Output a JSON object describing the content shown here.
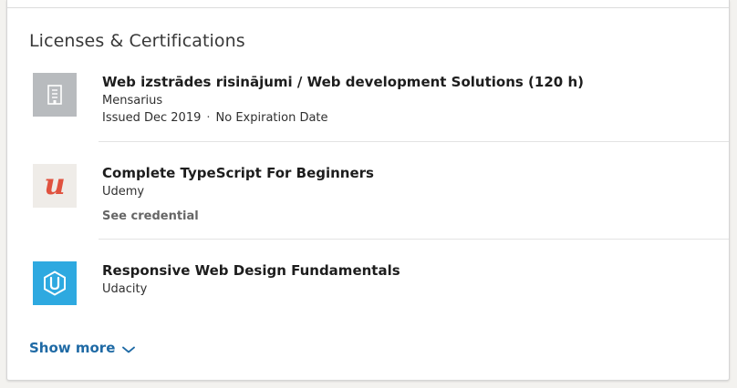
{
  "section": {
    "title": "Licenses & Certifications"
  },
  "certifications": [
    {
      "title": "Web izstrādes risinājumi / Web development Solutions (120 h)",
      "issuer": "Mensarius",
      "issued": "Issued Dec 2019",
      "expiration": "No Expiration Date",
      "logo_icon": "building-icon"
    },
    {
      "title": "Complete TypeScript For Beginners",
      "issuer": "Udemy",
      "credential_link": "See credential",
      "logo_icon": "udemy-logo-icon",
      "logo_letter": "u"
    },
    {
      "title": "Responsive Web Design Fundamentals",
      "issuer": "Udacity",
      "logo_icon": "udacity-logo-icon"
    }
  ],
  "footer": {
    "show_more_label": "Show more",
    "show_more_icon": "chevron-down-icon"
  },
  "colors": {
    "link_blue": "#1f6aa5",
    "udemy_red": "#e0523f",
    "udacity_blue": "#2ea9e0",
    "placeholder_gray": "#b8bbbe"
  }
}
